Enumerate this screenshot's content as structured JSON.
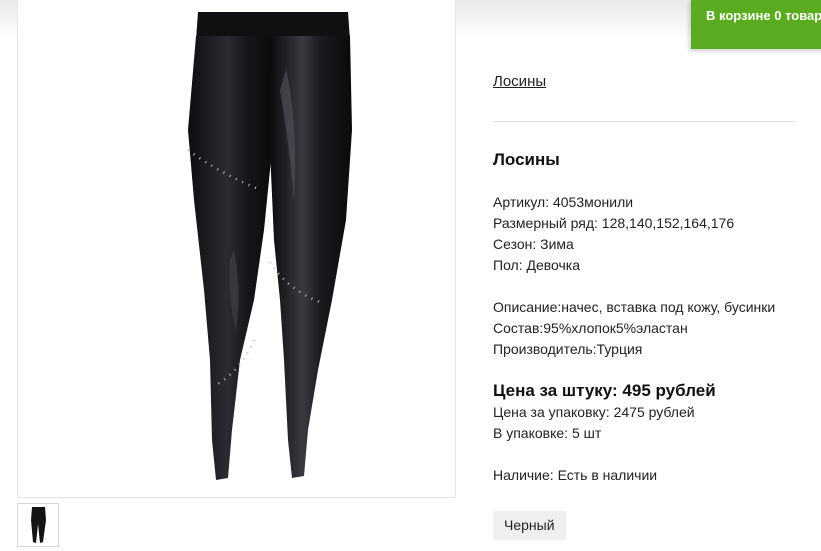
{
  "cart": {
    "label": "В корзине",
    "count": "0",
    "suffix": "товаров"
  },
  "breadcrumb": "Лосины",
  "product": {
    "title": "Лосины",
    "article": "Артикул: 4053монили",
    "sizes": "Размерный ряд: 128,140,152,164,176",
    "season": "Сезон: Зима",
    "gender": "Пол: Девочка",
    "description": "Описание:начес, вставка под кожу, бусинки",
    "composition": "Состав:95%хлопок5%эластан",
    "manufacturer": "Производитель:Турция",
    "price_unit": "Цена за штуку: 495 рублей",
    "price_pack": "Цена за упаковку: 2475 рублей",
    "pack_qty": "В упаковке: 5 шт",
    "availability": "Наличие: Есть в наличии",
    "color_option": "Черный"
  },
  "colors": {
    "accent": "#5aab1f",
    "product": "#111114"
  }
}
